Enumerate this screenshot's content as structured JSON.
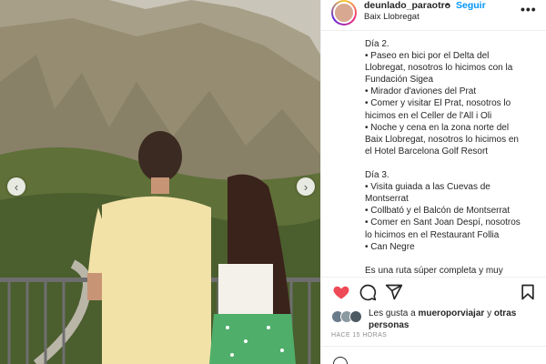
{
  "post": {
    "username": "deunlado_paraotro",
    "separator": "•",
    "follow_label": "Seguir",
    "location": "Baix Llobregat",
    "more_label": "•••"
  },
  "photo": {
    "prev_arrow": "‹",
    "next_arrow": "›"
  },
  "caption_lines": [
    "Día 2.",
    "• Paseo en bici por el Delta del",
    "Llobregat, nosotros lo hicimos con la",
    "Fundación Sigea",
    "• Mirador d'aviones del Prat",
    "• Comer y visitar El Prat, nosotros lo",
    "hicimos en el Celler de l'All i Oli",
    "• Noche y cena en la zona norte del",
    "Baix Llobregat, nosotros lo hicimos en",
    "el Hotel Barcelona Golf Resort",
    "",
    "Día 3.",
    "• Visita guiada a las Cuevas de",
    "Montserrat",
    "• Collbató y el Balcón de Montserrat",
    "• Comer en Sant Joan Despí, nosotros",
    "lo hicimos en el Restaurant Follia",
    "• Can Negre",
    "",
    "Es una ruta súper completa y muy"
  ],
  "likes": {
    "prefix": "Les gusta a ",
    "user": "mueroporviajar",
    "middle": " y ",
    "others": "otras personas"
  },
  "timestamp": "HACE 15 HORAS",
  "icons": [
    "heart-icon",
    "comment-icon",
    "share-icon",
    "bookmark-icon",
    "chevron-left-icon",
    "chevron-right-icon",
    "more-icon"
  ],
  "colors": {
    "like": "#ed4956",
    "link": "#0095f6",
    "muted": "#8e8e8e"
  }
}
